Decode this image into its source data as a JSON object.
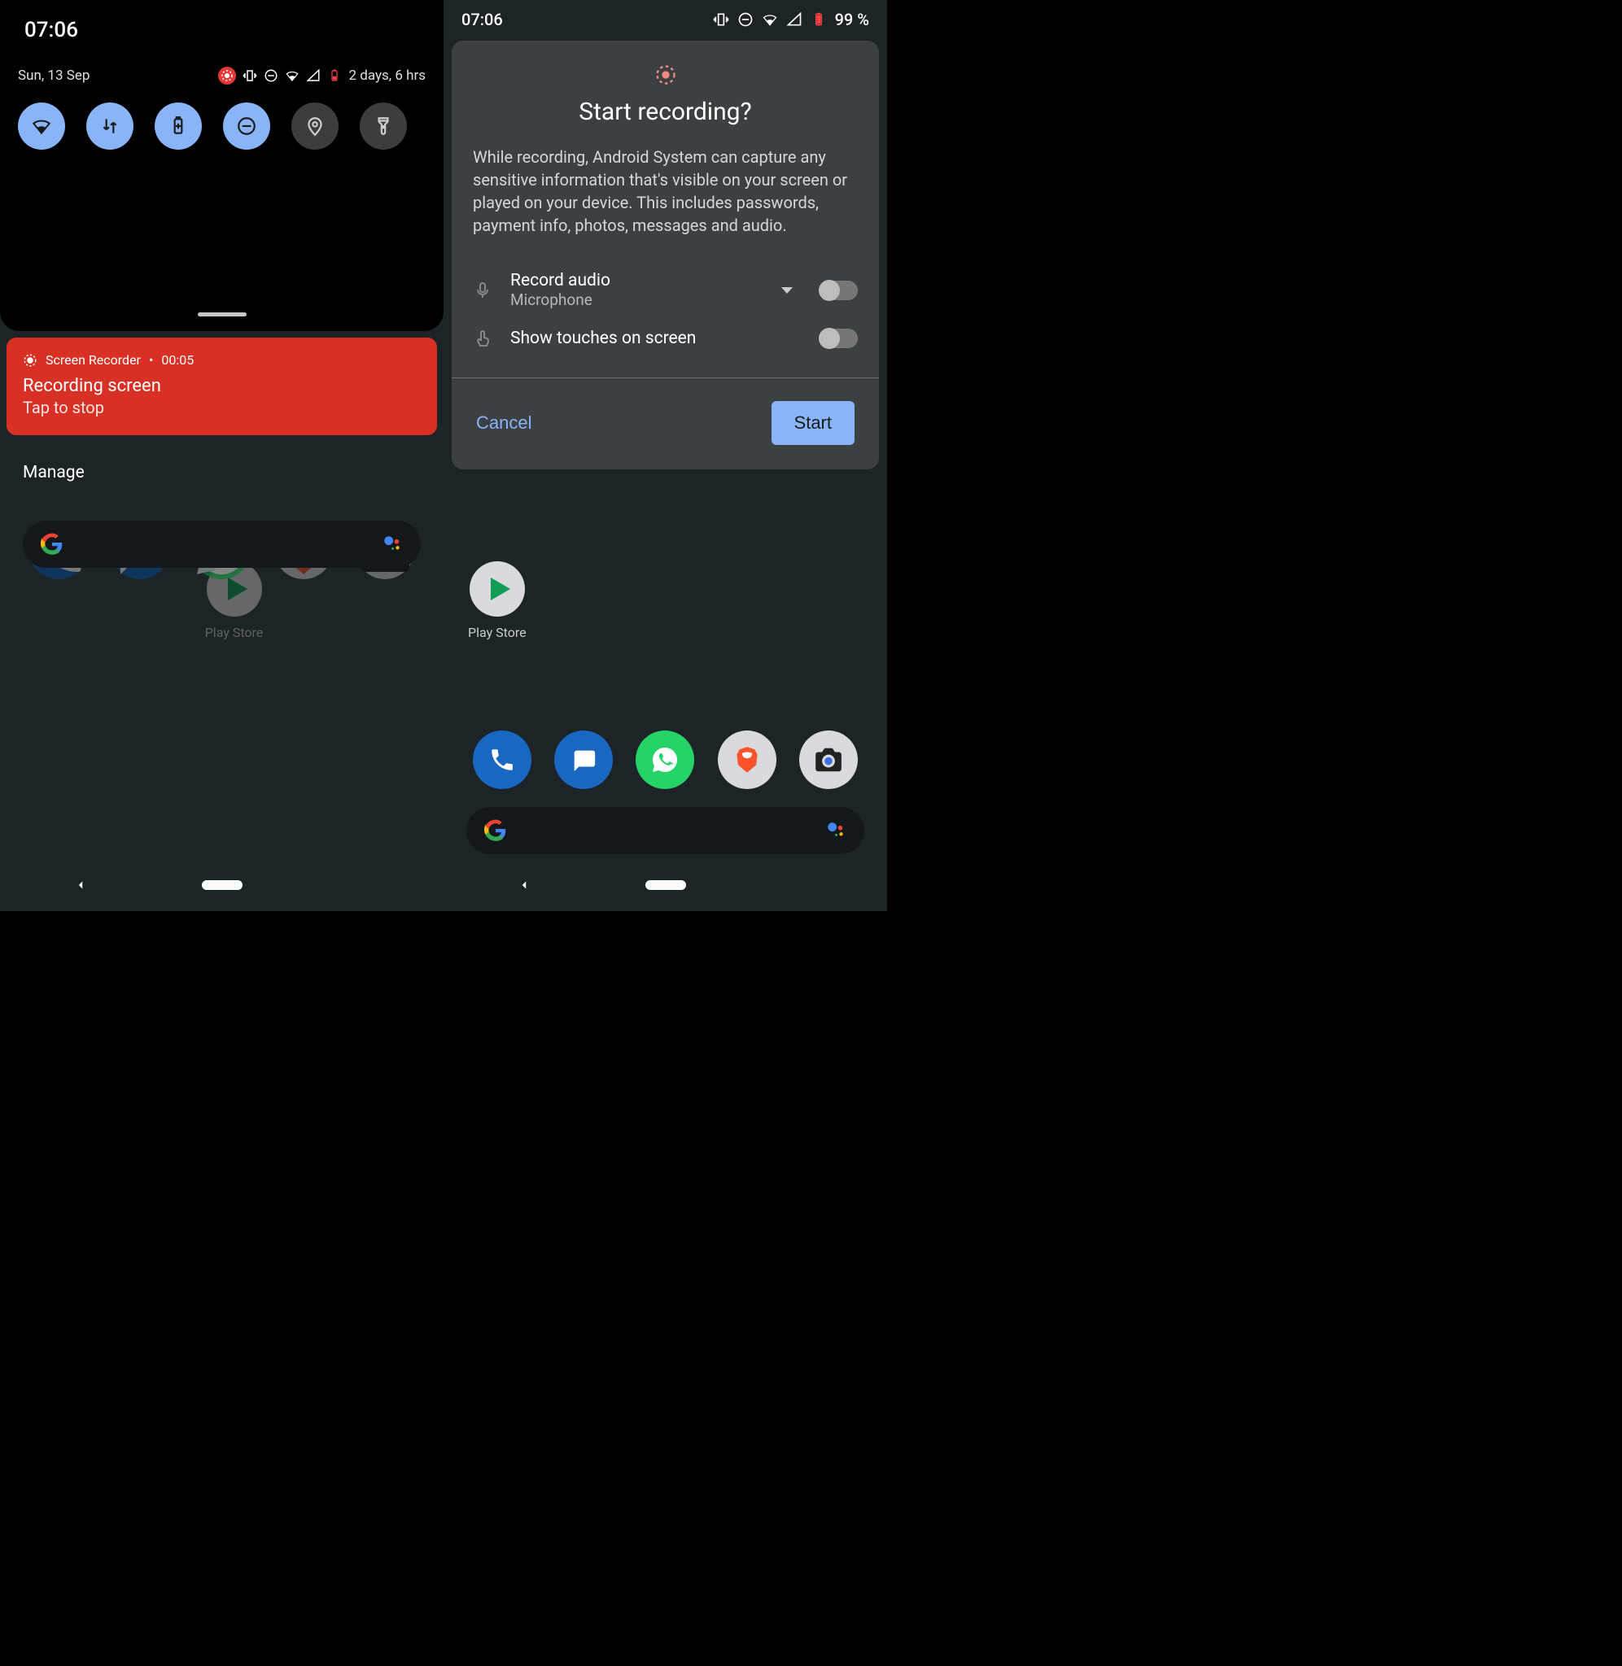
{
  "left": {
    "status_time": "07:06",
    "date": "Sun, 13 Sep",
    "battery_hint": "2 days, 6 hrs",
    "tiles": [
      {
        "name": "wifi",
        "on": true
      },
      {
        "name": "data",
        "on": true
      },
      {
        "name": "battery",
        "on": true
      },
      {
        "name": "dnd",
        "on": true
      },
      {
        "name": "location",
        "on": false
      },
      {
        "name": "flashlight",
        "on": false
      }
    ],
    "notification": {
      "app": "Screen Recorder",
      "time": "00:05",
      "title": "Recording screen",
      "subtitle": "Tap to stop"
    },
    "manage_label": "Manage",
    "store_label": "Play Store"
  },
  "right": {
    "status_time": "07:06",
    "battery_pct": "99 %",
    "dialog": {
      "title": "Start recording?",
      "body": "While recording, Android System can capture any sensitive information that's visible on your screen or played on your device. This includes passwords, payment info, photos, messages and audio.",
      "record_audio_label": "Record audio",
      "record_audio_source": "Microphone",
      "show_touches_label": "Show touches on screen",
      "cancel": "Cancel",
      "start": "Start"
    },
    "store_label": "Play Store"
  },
  "dock": [
    {
      "name": "phone"
    },
    {
      "name": "messages"
    },
    {
      "name": "whatsapp"
    },
    {
      "name": "brave"
    },
    {
      "name": "camera"
    }
  ]
}
